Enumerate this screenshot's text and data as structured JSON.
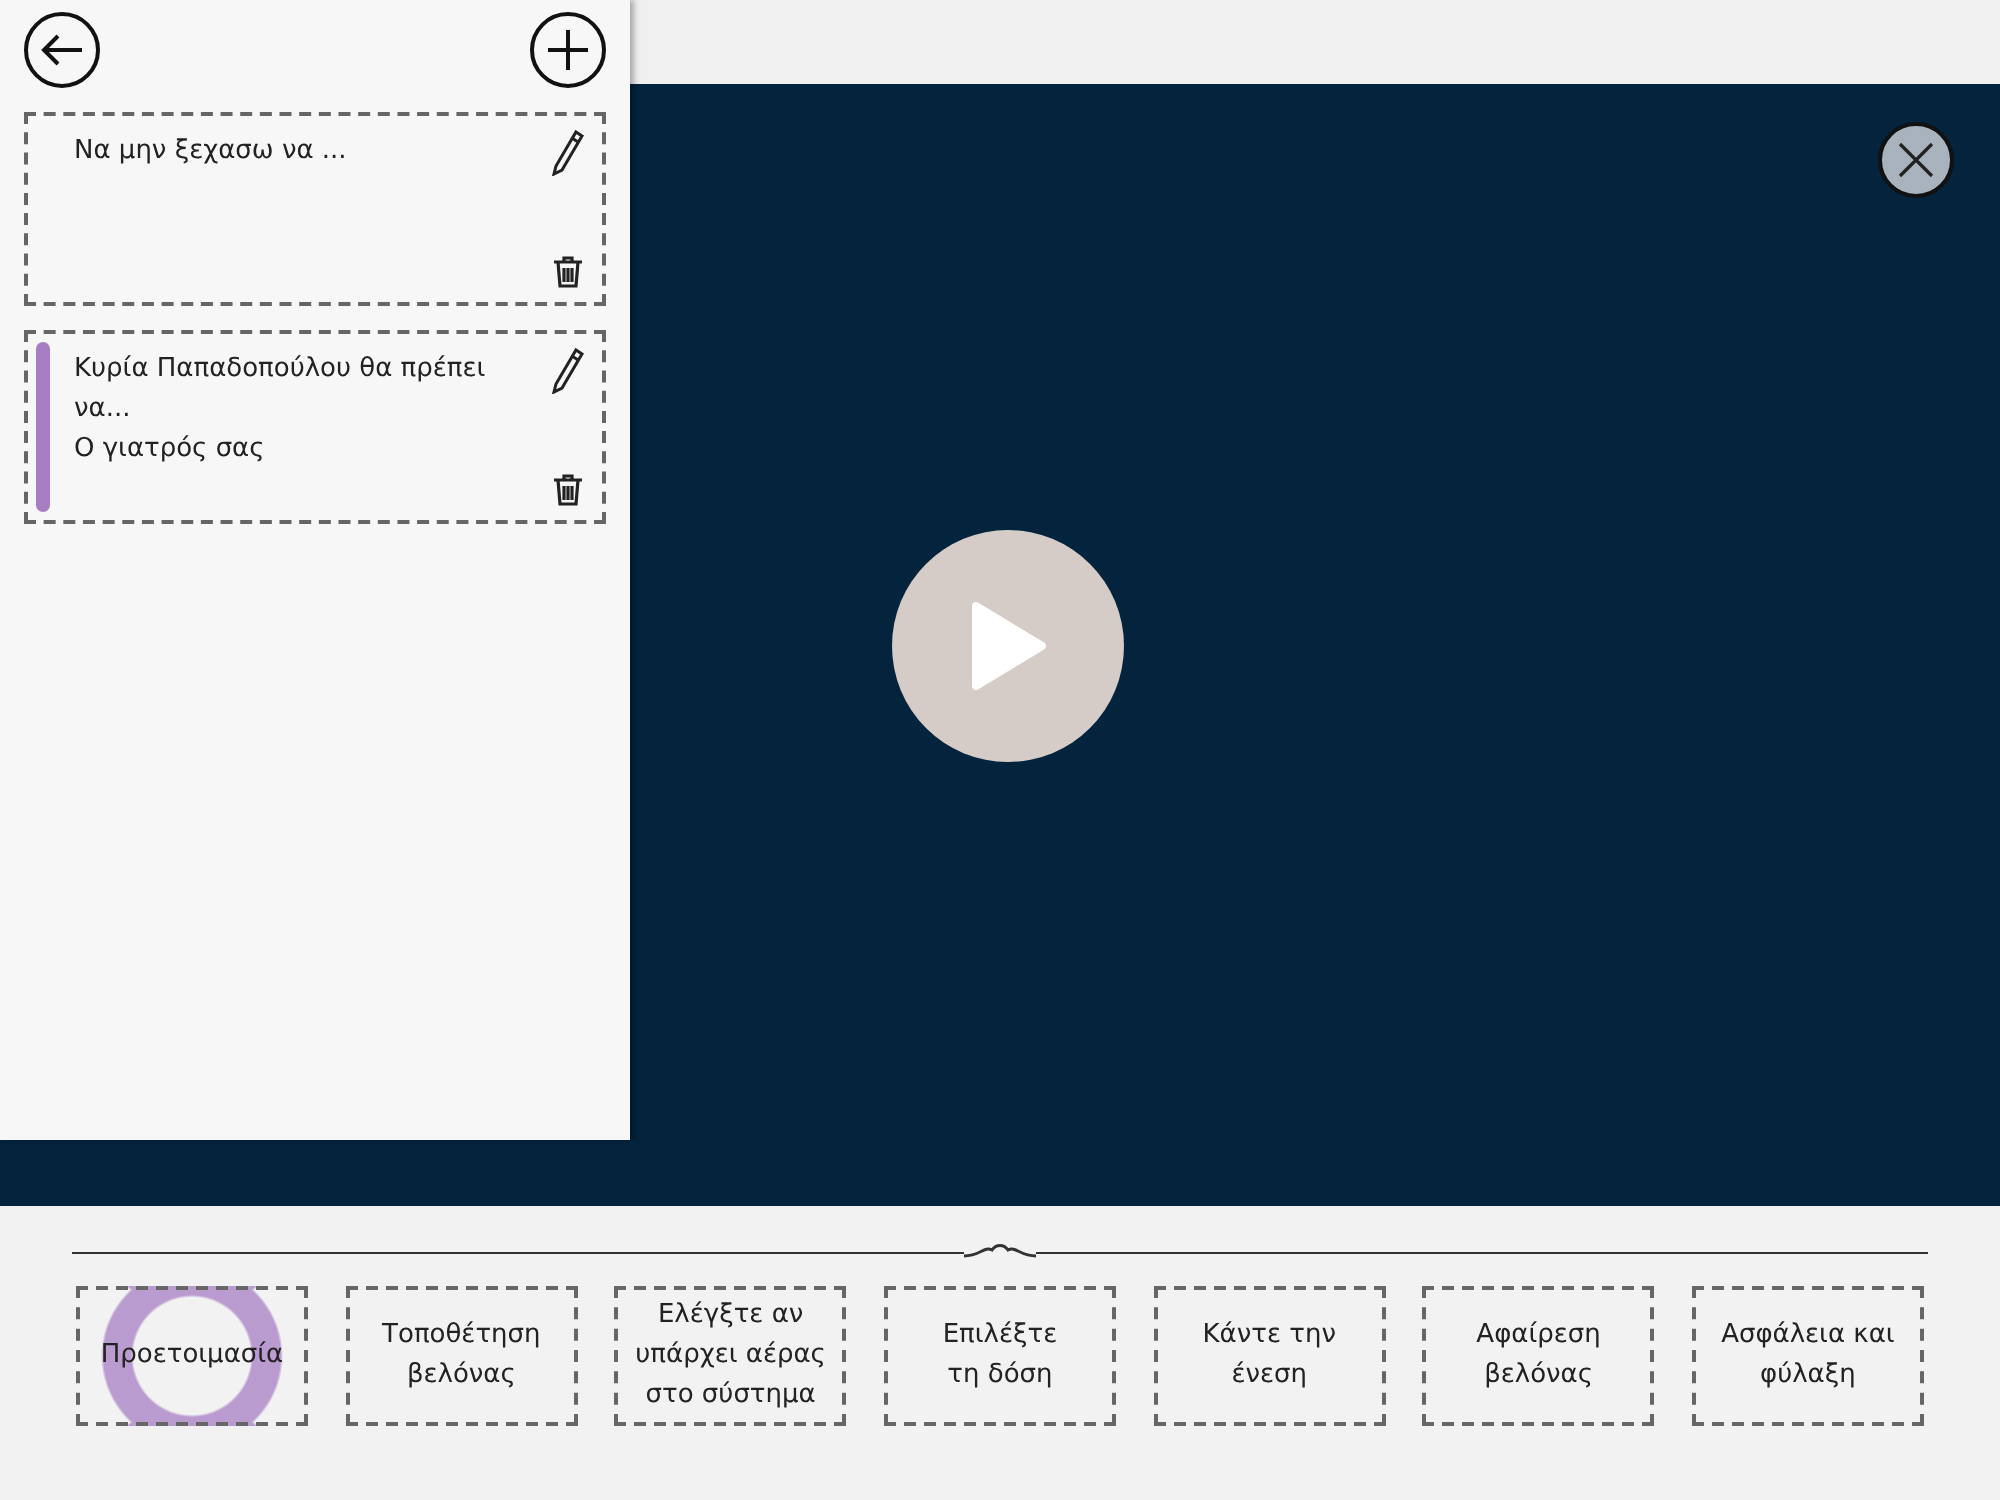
{
  "notes_panel": {
    "notes": [
      {
        "lines": [
          "Να μην ξεχασω να ..."
        ],
        "marked": false
      },
      {
        "lines": [
          "Κυρία Παπαδοπούλου θα πρέπει να...",
          "Ο γιατρός σας"
        ],
        "marked": true
      }
    ]
  },
  "steps": [
    {
      "lines": [
        "Προετοιμασία"
      ],
      "selected": true
    },
    {
      "lines": [
        "Τοποθέτηση",
        "βελόνας"
      ],
      "selected": false
    },
    {
      "lines": [
        "Ελέγξτε αν",
        "υπάρχει αέρας",
        "στο σύστημα"
      ],
      "selected": false
    },
    {
      "lines": [
        "Επιλέξτε",
        "τη δόση"
      ],
      "selected": false
    },
    {
      "lines": [
        "Κάντε την",
        "ένεση"
      ],
      "selected": false
    },
    {
      "lines": [
        "Αφαίρεση",
        "βελόνας"
      ],
      "selected": false
    },
    {
      "lines": [
        "Ασφάλεια και",
        "φύλαξη"
      ],
      "selected": false
    }
  ]
}
